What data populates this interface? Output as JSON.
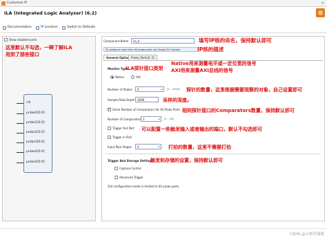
{
  "window": {
    "title": "Customize IP",
    "close_glyph": "×"
  },
  "header": {
    "title": "ILA (Integrated Logic Analyzer) (6.2)"
  },
  "toolbar": {
    "documentation": "Documentation",
    "ip_location": "IP Location",
    "switch_defaults": "Switch to Defaults"
  },
  "left": {
    "show_disabled_ports": "Show disabled ports",
    "annotation": [
      "这里默认不勾选，一瞬了解ILA",
      "用到了那些接口"
    ],
    "pins": [
      "clk",
      "probe0[0:0]",
      "probe1[0:0]",
      "probe2[0:0]",
      "probe3[0:0]",
      "probe4[0:0]",
      "probe5[0:0]"
    ]
  },
  "right": {
    "component_name_label": "Component Name",
    "component_name_value": "ila_0",
    "component_name_annotation": "填写IP核的命名，保持默认即可",
    "info_text": "To configure more than 64 probe ports use Vivado Tcl Console",
    "info_annotation": "IP核的描述",
    "tabs": [
      "General Options",
      "Probe_Ports(0..5)"
    ],
    "monitor_type_label": "Monitor Type",
    "monitor_annotation": "ILA探针接口类型",
    "native_annotation": "Native用来测量电平或一定位宽的信号",
    "axi_annotation": "AXI用来测量AXI总线的信号",
    "native_label": "Native",
    "axi_label": "AXI",
    "num_probes_label": "Number of Probes",
    "num_probes_value": "6",
    "num_probes_range": "[1 .. 1024]",
    "probes_annotation": "探针的数量，这里根据需要观察的对象，自己设置即可",
    "sample_depth_label": "Sample Data Depth",
    "sample_depth_value": "4096",
    "sample_depth_annotation": "采样的深度。",
    "same_comparators_label": "Same Number of Comparators for All Probe Ports",
    "same_comparators_annotation": "相同探针接口的Comparators数量，保持默认即可",
    "num_comparators_label": "Number of Comparators",
    "num_comparators_value": "1",
    "num_comparators_range": "[1 .. 16]",
    "trigger_out_label": "Trigger Out Port",
    "trigger_in_label": "Trigger In Port",
    "trigger_annotation": "可以配置一些触发输入或者输出的端口，默认不勾选即可",
    "input_pipe_label": "Input Pipe Stages",
    "input_pipe_value": "0",
    "input_pipe_annotation": "打拍的数量，这里不需要打拍",
    "trigger_storage_label": "Trigger And Storage Settings",
    "trigger_storage_annotation": "触发和存储的设置，保持默认即可",
    "capture_control_label": "Capture Control",
    "advanced_trigger_label": "Advanced Trigger",
    "gui_note": "GUI configuration mode is limited to 64 probe ports."
  },
  "footer": {
    "watermark": "CSDN @小刘不加班"
  },
  "colors": {
    "annotation": "#e01010",
    "accent": "#1a4e9c"
  }
}
